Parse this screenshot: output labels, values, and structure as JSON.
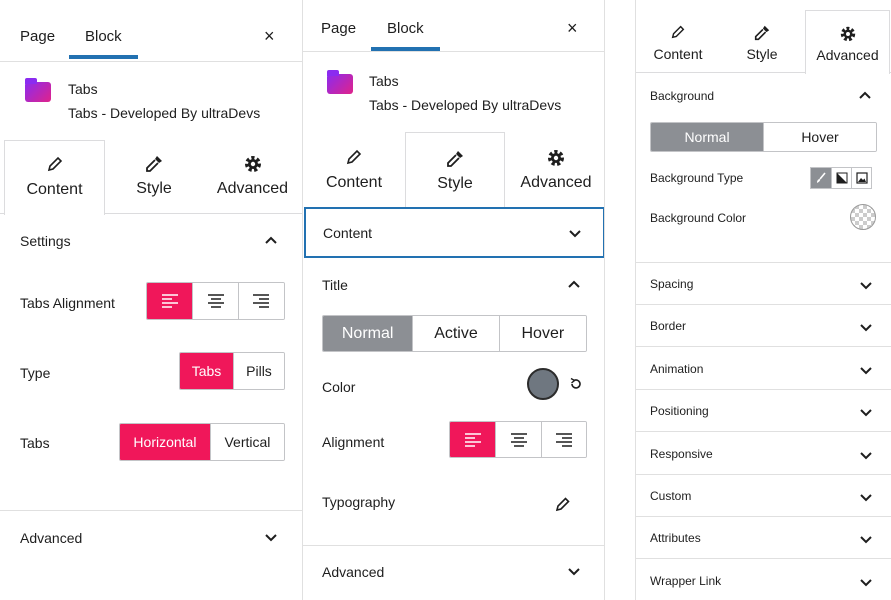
{
  "panel1": {
    "header": {
      "tab_page": "Page",
      "tab_block": "Block",
      "close": "×"
    },
    "block": {
      "name": "Tabs",
      "description": "Tabs - Developed By ultraDevs"
    },
    "tabs": {
      "content": "Content",
      "style": "Style",
      "advanced": "Advanced"
    },
    "settings_title": "Settings",
    "tabs_alignment_label": "Tabs Alignment",
    "type_label": "Type",
    "type_options": [
      "Tabs",
      "Pills"
    ],
    "tabs_label": "Tabs",
    "orientation_options": [
      "Horizontal",
      "Vertical"
    ],
    "advanced_title": "Advanced"
  },
  "panel2": {
    "header": {
      "tab_page": "Page",
      "tab_block": "Block",
      "close": "×"
    },
    "block": {
      "name": "Tabs",
      "description": "Tabs - Developed By ultraDevs"
    },
    "tabs": {
      "content": "Content",
      "style": "Style",
      "advanced": "Advanced"
    },
    "content_title": "Content",
    "title_section": "Title",
    "state_options": [
      "Normal",
      "Active",
      "Hover"
    ],
    "color_label": "Color",
    "alignment_label": "Alignment",
    "typography_label": "Typography",
    "advanced_title": "Advanced"
  },
  "panel3": {
    "tabs": {
      "content": "Content",
      "style": "Style",
      "advanced": "Advanced"
    },
    "background_title": "Background",
    "state_options": [
      "Normal",
      "Hover"
    ],
    "background_type_label": "Background Type",
    "background_color_label": "Background Color",
    "accordions": [
      "Spacing",
      "Border",
      "Animation",
      "Positioning",
      "Responsive",
      "Custom",
      "Attributes",
      "Wrapper Link"
    ]
  },
  "colors": {
    "accent_pink": "#f0175a",
    "accent_blue": "#2271b1",
    "swatch": "#6f7780"
  }
}
